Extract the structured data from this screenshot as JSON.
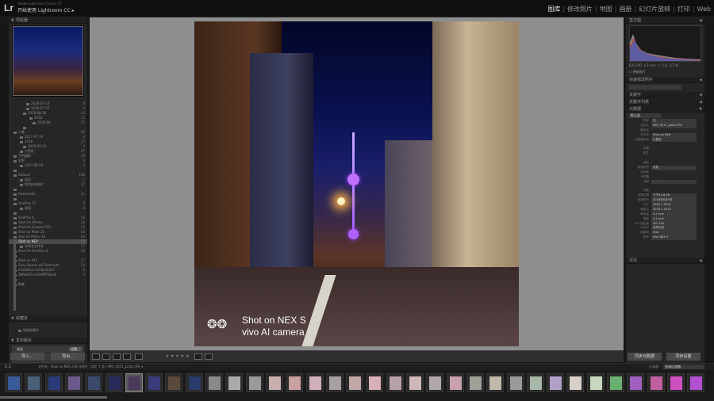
{
  "app": {
    "logo": "Lr",
    "subtitle": "Adobe Lightroom Classic CC",
    "title": "开始使用 Lightroom CC",
    "title_caret": "▸"
  },
  "modules": [
    "图库",
    "修改照片",
    "地图",
    "画册",
    "幻灯片放映",
    "打印",
    "Web"
  ],
  "module_separator": "|",
  "left_panel": {
    "navigator_label": "导航器",
    "folders": [
      {
        "label": "2018-07-24",
        "count": "8"
      },
      {
        "label": "2018-07-25",
        "count": "9"
      },
      {
        "label": "2018-08-30",
        "count": "23"
      },
      {
        "label": "2018",
        "count": "11"
      },
      {
        "label": "2018-08",
        "count": "11"
      },
      {
        "label": "",
        "count": ""
      },
      {
        "label": "人像",
        "count": "82"
      },
      {
        "label": "2017-07-10",
        "count": "6"
      },
      {
        "label": "2018",
        "count": "27"
      },
      {
        "label": "2018-05-23",
        "count": "4"
      },
      {
        "label": "小黑柜",
        "count": "27"
      },
      {
        "label": "手机摄影",
        "count": "19"
      },
      {
        "label": "狂野",
        "count": "6"
      },
      {
        "label": "2017-06-09",
        "count": "6"
      },
      {
        "label": "",
        "count": ""
      },
      {
        "label": "Dxiaoxi",
        "count": "188"
      },
      {
        "label": "成品",
        "count": "1"
      },
      {
        "label": "我的拍的图片",
        "count": "17"
      },
      {
        "label": "",
        "count": ""
      },
      {
        "label": "Hueistudio",
        "count": "21"
      },
      {
        "label": "",
        "count": ""
      },
      {
        "label": "OnePlus 5T",
        "count": "8"
      },
      {
        "label": "原图",
        "count": "8"
      },
      {
        "label": "",
        "count": ""
      },
      {
        "label": "OnePlus 6",
        "count": "46"
      },
      {
        "label": "Shot On iPhone",
        "count": "30"
      },
      {
        "label": "Shot On Huawei P20",
        "count": "24"
      },
      {
        "label": "Shot on Mate 20",
        "count": "40"
      },
      {
        "label": "shot on Meizu 16",
        "count": "40"
      },
      {
        "label": "Shot on NEX",
        "count": "238",
        "selected": true
      },
      {
        "label": "未命名文件夹",
        "count": "37"
      },
      {
        "label": "Shot On OnePlus 6",
        "count": "18"
      },
      {
        "label": "",
        "count": ""
      },
      {
        "label": "Shot on R11",
        "count": "27"
      },
      {
        "label": "Sony Xperia xz2 Premium",
        "count": "24"
      },
      {
        "label": "e2eb92c5.nn56e1b5d7",
        "count": "8"
      },
      {
        "label": "2BNmH5nhG5MRTDbnQ",
        "count": "2"
      },
      {
        "label": "",
        "count": ""
      },
      {
        "label": "影集",
        "count": ""
      }
    ],
    "collections_label": "收藏夹",
    "collection_item": "智能收藏夹",
    "publish_label": "发布服务",
    "publish_items": [
      {
        "label": "硬盘",
        "btn": "设置..."
      },
      {
        "label": "Adobe Stock",
        "btn": "设置..."
      },
      {
        "label": "Flickr",
        "btn": "设置..."
      }
    ],
    "import": "导入...",
    "export": "导出..."
  },
  "right_panel": {
    "histogram_label": "直方图",
    "original_photo": "原始照片",
    "hist_info": [
      "ISO 200",
      "4.2 mm",
      "f / 1.8",
      "1/3 秒"
    ],
    "quick_develop": "快速修改照片",
    "keywording": "关键字",
    "keyword_list": "关键字列表",
    "metadata": "元数据",
    "meta_preset": "默认值",
    "metadata_rows": [
      {
        "k": "预设",
        "v": "无"
      },
      {
        "k": "文件名",
        "v": "IMG_0011_polarr.JPG"
      },
      {
        "k": "副本名",
        "v": ""
      },
      {
        "k": "文件夹",
        "v": "Shot on NEX"
      },
      {
        "k": "元数据状态",
        "v": "已更改"
      },
      {
        "k": "",
        "v": ""
      },
      {
        "k": "标题",
        "v": ""
      },
      {
        "k": "题注",
        "v": ""
      },
      {
        "k": "",
        "v": ""
      },
      {
        "k": "版权",
        "v": ""
      },
      {
        "k": "版权状态",
        "v": "未知"
      },
      {
        "k": "创作者",
        "v": ""
      },
      {
        "k": "子位置",
        "v": ""
      },
      {
        "k": "评级",
        "v": "· · · · ·"
      },
      {
        "k": "",
        "v": ""
      },
      {
        "k": "标签",
        "v": ""
      },
      {
        "k": "拍摄日期",
        "v": "下午8:18:56"
      },
      {
        "k": "拍摄时间",
        "v": "2018年6月9日"
      },
      {
        "k": "尺寸",
        "v": "3024 x 3013"
      },
      {
        "k": "裁剪后",
        "v": "3024 x 3013"
      },
      {
        "k": "曝光度",
        "v": "4.2 mm"
      },
      {
        "k": "焦距",
        "v": "4.2 mm"
      },
      {
        "k": "ISO 感光度",
        "v": "ISO 200"
      },
      {
        "k": "闪光灯",
        "v": "没有闪光"
      },
      {
        "k": "制造商",
        "v": "vivo"
      },
      {
        "k": "型号",
        "v": "vivo NEX S"
      },
      {
        "k": "",
        "v": ""
      }
    ],
    "comments": "评论",
    "sync_meta": "同步元数据",
    "sync_settings": "同步设置"
  },
  "photo": {
    "wm_logo": "❂❂",
    "wm_line1": "Shot on NEX S",
    "wm_line2": "vivo AI camera"
  },
  "toolbar": {
    "stars": "★★★★★"
  },
  "filmstrip_bar": {
    "pages": "1  2",
    "path": "文件夹 : Shot on NEX   238 张照片 / 选定 1 张 / IMG_0011_polarr.JPG ▾",
    "filter_label": "过滤器 :",
    "filter_value": "关闭过滤器"
  },
  "filmstrip": {
    "thumb_colors": [
      "#3a5a9a",
      "#4a6078",
      "#2a3a7a",
      "#6a5a8a",
      "#3a4a6a",
      "#2a2a5a",
      "#4a3a5a",
      "#3a3a7a",
      "#5a4a3a",
      "#2a3a6a",
      "#8a8a8a",
      "#aaaaaa",
      "#9a9a9a",
      "#c8b0b0",
      "#c8a0a0",
      "#d0b0b8",
      "#a8a0a0",
      "#c0a8a8",
      "#d8b0b8",
      "#b8a0a8",
      "#d0b8b8",
      "#b0a8a8",
      "#c8a0b0",
      "#a0a098",
      "#c0b8a8",
      "#9a9a9a",
      "#a8b8a8",
      "#b0a0c8",
      "#d8d0c8",
      "#c8d8c0",
      "#6ab070",
      "#a060c0",
      "#c060a0",
      "#d050c0",
      "#b050d0"
    ],
    "selected_index": 6
  }
}
